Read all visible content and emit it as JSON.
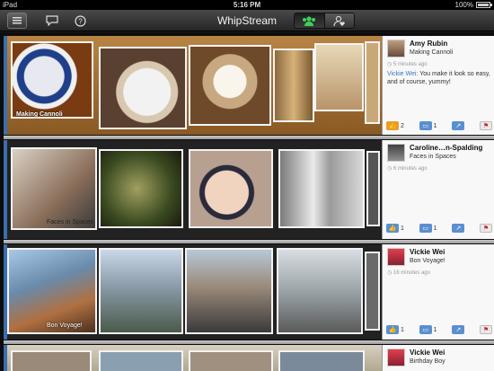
{
  "status_bar": {
    "device": "iPad",
    "time": "5:16 PM",
    "battery": "100%",
    "battery_level": 1.0
  },
  "navbar": {
    "title": "WhipStream",
    "icons": [
      "list-menu-icon",
      "chat-bubble-icon",
      "help-icon",
      "group-icon",
      "person-heart-icon"
    ]
  },
  "streams": [
    {
      "caption": "Making Cannoli",
      "card": {
        "user": "Amy Rubin",
        "title": "Making Cannoli",
        "time": "5 minutes ago",
        "commenter": "Vickie Wei:",
        "comment": "You make it look so easy, and of course, yummy!",
        "likes": "2",
        "comments": "1"
      }
    },
    {
      "caption": "Faces in Spaces",
      "card": {
        "user": "Caroline…n-Spalding",
        "title": "Faces in Spaces",
        "time": "6 minutes ago",
        "likes": "1",
        "comments": "1"
      }
    },
    {
      "caption": "Bon Voyage!",
      "card": {
        "user": "Vickie Wei",
        "title": "Bon Voyage!",
        "time": "16 minutes ago",
        "likes": "1",
        "comments": "1"
      }
    },
    {
      "caption": "",
      "card": {
        "user": "Vickie Wei",
        "title": "Birthday Boy"
      }
    }
  ],
  "colors": {
    "accent_blue": "#3a74c4",
    "like_orange": "#e99d2a",
    "flag_red": "#d02020"
  }
}
